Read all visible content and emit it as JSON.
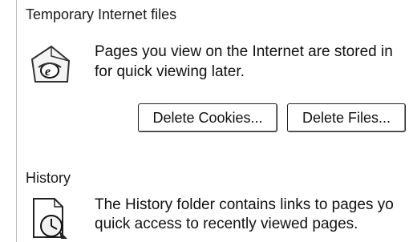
{
  "temp_files": {
    "title": "Temporary Internet files",
    "description_line1": "Pages you view on the Internet are stored in",
    "description_line2": "for quick viewing later.",
    "delete_cookies_label": "Delete Cookies...",
    "delete_files_label": "Delete Files...",
    "icon": "ie-temp-files-icon"
  },
  "history": {
    "title": "History",
    "description_line1": "The History folder contains links to pages yo",
    "description_line2": "quick access to recently viewed pages.",
    "icon": "history-clock-icon"
  }
}
